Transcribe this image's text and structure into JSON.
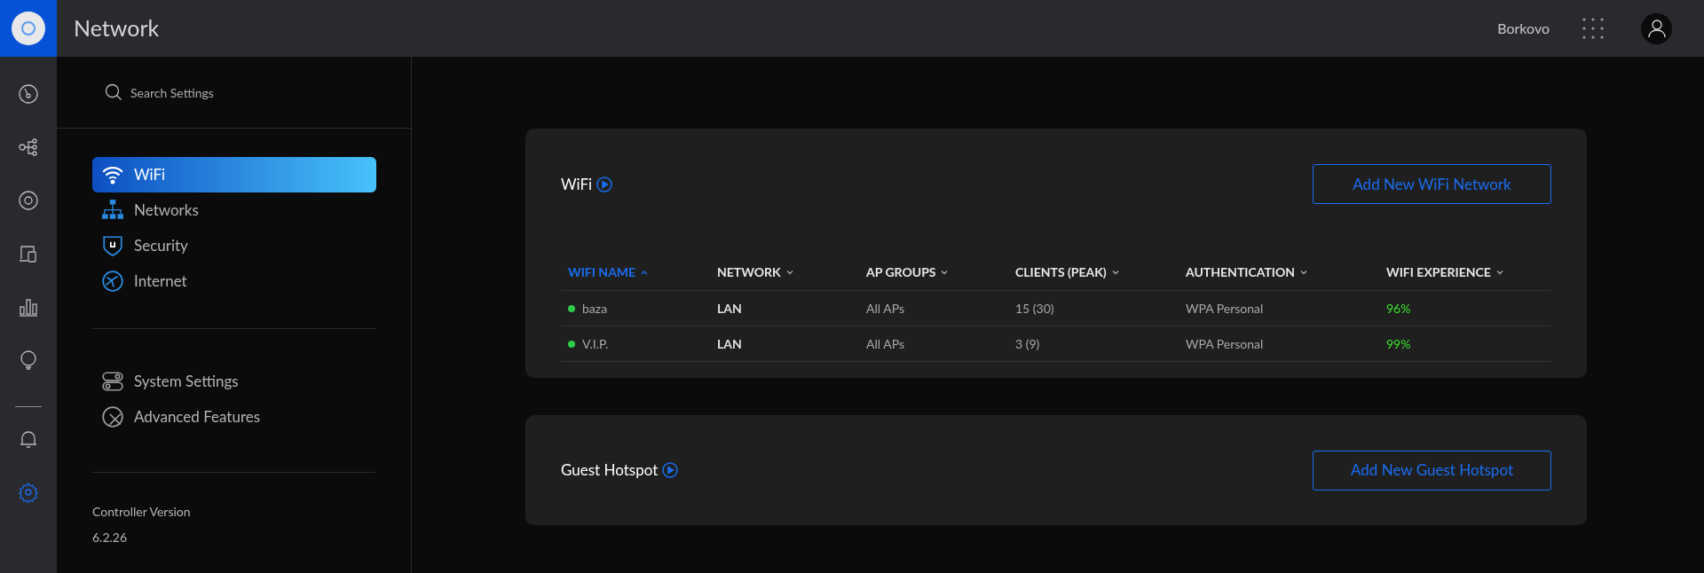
{
  "header": {
    "title": "Network",
    "site": "Borkovo"
  },
  "rail": [
    {
      "kind": "dashboard",
      "selected": false
    },
    {
      "kind": "topology",
      "selected": false
    },
    {
      "kind": "devices",
      "selected": false
    },
    {
      "kind": "clients",
      "selected": false
    },
    {
      "kind": "statistics",
      "selected": false
    },
    {
      "kind": "insights",
      "selected": false
    },
    {
      "kind": "alerts",
      "selected": false
    },
    {
      "kind": "settings",
      "selected": true
    }
  ],
  "sidebar": {
    "search": {
      "placeholder": "Search Settings"
    },
    "groups": [
      [
        {
          "label": "WiFi",
          "kind": "wifi",
          "selected": true
        },
        {
          "label": "Networks",
          "kind": "networks",
          "selected": false
        },
        {
          "label": "Security",
          "kind": "security",
          "selected": false
        },
        {
          "label": "Internet",
          "kind": "internet",
          "selected": false
        }
      ],
      [
        {
          "label": "System Settings",
          "kind": "system",
          "selected": false
        },
        {
          "label": "Advanced Features",
          "kind": "advanced",
          "selected": false
        }
      ]
    ],
    "version_label": "Controller Version",
    "version": "6.2.26"
  },
  "wifi": {
    "title": "WiFi",
    "button": "Add New WiFi Network",
    "table": {
      "columns": [
        {
          "label": "WIFI NAME",
          "sorted": true
        },
        {
          "label": "NETWORK",
          "sorted": false
        },
        {
          "label": "AP GROUPS",
          "sorted": false
        },
        {
          "label": "CLIENTS (PEAK)",
          "sorted": false
        },
        {
          "label": "AUTHENTICATION",
          "sorted": false
        },
        {
          "label": "WIFI EXPERIENCE",
          "sorted": false
        }
      ],
      "rows": [
        {
          "color": "#2fcc4a",
          "cells": [
            "baza",
            "LAN",
            "All APs",
            "15 (30)",
            "WPA Personal",
            "96%"
          ]
        },
        {
          "color": "#2fcc4a",
          "cells": [
            "V.I.P.",
            "LAN",
            "All APs",
            "3 (9)",
            "WPA Personal",
            "99%"
          ]
        }
      ]
    }
  },
  "guest": {
    "title": "Guest Hotspot",
    "button": "Add New Guest Hotspot"
  }
}
